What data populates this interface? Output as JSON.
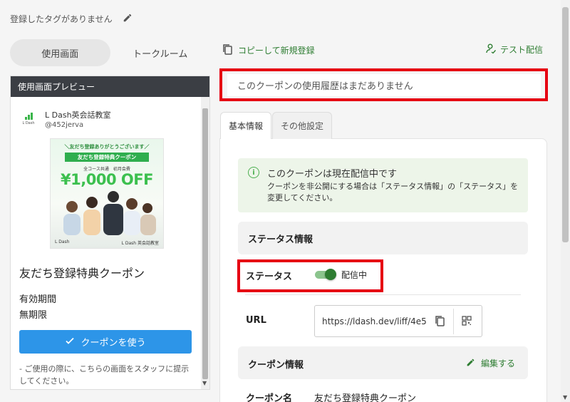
{
  "tagline": {
    "text": "登録したタグがありません"
  },
  "left_tabs": [
    {
      "label": "使用画面",
      "active": true
    },
    {
      "label": "トークルーム",
      "active": false
    }
  ],
  "preview": {
    "header": "使用画面プレビュー",
    "account_name": "L Dash英会話教室",
    "account_id": "@452jerva",
    "logo_text": "L Dash",
    "banner": {
      "top_text": "＼友だち登録ありがとうございます／",
      "ribbon": "友だち登録特典クーポン",
      "subtitle": "全コース共通　初月会費",
      "offer": "¥1,000 OFF",
      "footer_logo": "L Dash",
      "footer_right": "L Dash 英会話教室"
    },
    "coupon_title": "友だち登録特典クーポン",
    "period_label": "有効期間",
    "period_value": "無期限",
    "use_button": "クーポンを使う",
    "note": "- ご使用の際に、こちらの画面をスタッフに提示してください。"
  },
  "actions": {
    "copy_new": "コピーして新規登録",
    "test_send": "テスト配信"
  },
  "history": {
    "text": "このクーポンの使用履歴はまだありません"
  },
  "right_tabs": [
    {
      "label": "基本情報",
      "active": true
    },
    {
      "label": "その他設定",
      "active": false
    }
  ],
  "info": {
    "title": "このクーポンは現在配信中です",
    "text": "クーポンを非公開にする場合は「ステータス情報」の「ステータス」を変更してください。"
  },
  "status_section": {
    "heading": "ステータス情報",
    "label": "ステータス",
    "toggle_on": true,
    "toggle_text": "配信中"
  },
  "url_section": {
    "label": "URL",
    "value": "https://ldash.dev/liff/4e5"
  },
  "coupon_info": {
    "heading": "クーポン情報",
    "edit": "編集する",
    "name_label": "クーポン名",
    "name_value": "友だち登録特典クーポン"
  },
  "colors": {
    "accent_green": "#2e7d32",
    "highlight_red": "#e60012",
    "primary_blue": "#2d95e8",
    "info_bg": "#edf5e9"
  }
}
